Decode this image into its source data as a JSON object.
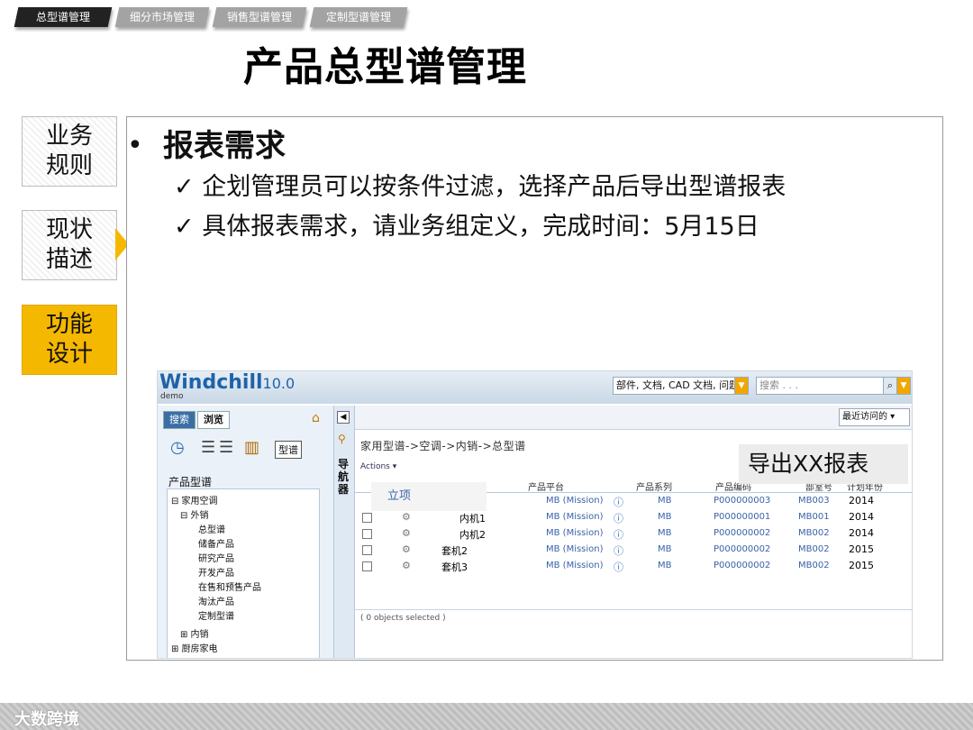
{
  "tabs": [
    "总型谱管理",
    "细分市场管理",
    "销售型谱管理",
    "定制型谱管理"
  ],
  "page_title": "产品总型谱管理",
  "side_nav": [
    {
      "line1": "业务",
      "line2": "规则"
    },
    {
      "line1": "现状",
      "line2": "描述"
    },
    {
      "line1": "功能",
      "line2": "设计"
    }
  ],
  "content": {
    "bullet": "•",
    "heading": "报表需求",
    "items": [
      "✓ 企划管理员可以按条件过滤，选择产品后导出型谱报表",
      "✓ 具体报表需求，请业务组定义，完成时间：5月15日"
    ]
  },
  "windchill": {
    "logo": "Windchill",
    "version": "10.0",
    "demo": "demo",
    "scope": "部件, 文档, CAD 文档, 问题报告",
    "search_placeholder": "搜索 . . .",
    "tab_search": "搜索",
    "tab_browse": "浏览",
    "tool_label": "型谱",
    "tree_title": "产品型谱",
    "tree": [
      "⊟ 家用空调",
      "⊟ 外销",
      "总型谱",
      "储备产品",
      "研究产品",
      "开发产品",
      "在售和预售产品",
      "淘汰产品",
      "定制型谱",
      "⊞ 内销",
      "⊞ 厨房家电"
    ],
    "nav_vertical": "导航器",
    "recent": "最近访问的 ▾",
    "breadcrumb": "家用型谱->空调->内销->总型谱",
    "actions": "Actions ▾",
    "columns": [
      "产品平台",
      "产品系列",
      "产品编码",
      "部室号",
      "计划年份"
    ],
    "popup": "立项",
    "rows": [
      {
        "name": "",
        "platform": "MB (Mission)",
        "series": "MB",
        "code": "P000000003",
        "dept": "MB003",
        "year": "2014"
      },
      {
        "name": "内机1",
        "platform": "MB (Mission)",
        "series": "MB",
        "code": "P000000001",
        "dept": "MB001",
        "year": "2014"
      },
      {
        "name": "内机2",
        "platform": "MB (Mission)",
        "series": "MB",
        "code": "P000000002",
        "dept": "MB002",
        "year": "2014"
      },
      {
        "name": "套机2",
        "platform": "MB (Mission)",
        "series": "MB",
        "code": "P000000002",
        "dept": "MB002",
        "year": "2015"
      },
      {
        "name": "套机3",
        "platform": "MB (Mission)",
        "series": "MB",
        "code": "P000000002",
        "dept": "MB002",
        "year": "2015"
      }
    ],
    "status": "( 0 objects selected )"
  },
  "export_label": "导出XX报表",
  "footer_brand": "大数跨境",
  "colors": {
    "accent": "#f5b800",
    "tab_active": "#222222",
    "tab_inactive": "#a3a3a3"
  }
}
